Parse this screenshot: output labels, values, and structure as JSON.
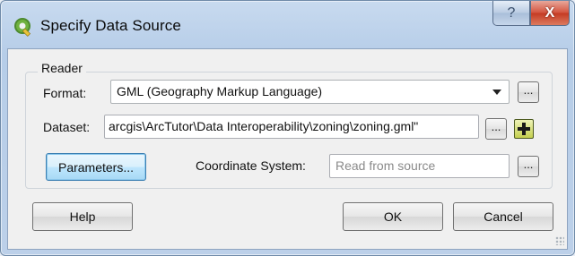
{
  "window": {
    "title": "Specify Data Source"
  },
  "titlebar_buttons": {
    "help": "?",
    "close": "X"
  },
  "reader": {
    "group_title": "Reader",
    "format": {
      "label": "Format:",
      "value": "GML (Geography Markup Language)",
      "browse": "..."
    },
    "dataset": {
      "label": "Dataset:",
      "value": "arcgis\\ArcTutor\\Data Interoperability\\zoning\\zoning.gml\"",
      "browse": "..."
    },
    "parameters_button": "Parameters...",
    "coordinate_system": {
      "label": "Coordinate System:",
      "placeholder": "Read from source",
      "browse": "..."
    }
  },
  "buttons": {
    "help": "Help",
    "ok": "OK",
    "cancel": "Cancel"
  },
  "colors": {
    "close_button": "#c43a22",
    "focus_border": "#3c7fb1",
    "add_button": "#c5d04f"
  }
}
